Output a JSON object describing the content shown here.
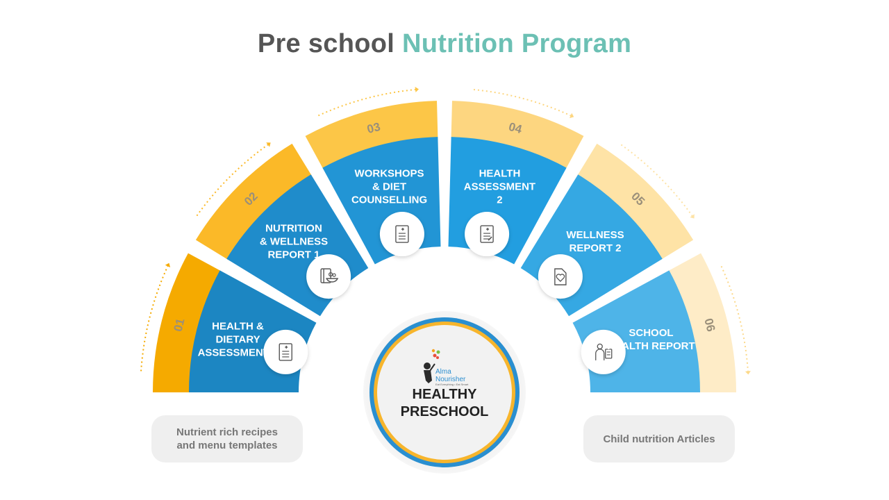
{
  "title": {
    "part1": "Pre school",
    "part2": "Nutrition Program"
  },
  "colors": {
    "title_dark": "#555555",
    "title_accent": "#6cc0b4",
    "center_ring_outer": "#2a8fd0",
    "center_ring_inner": "#f7b52c"
  },
  "center": {
    "logo_name": "Alma Nourisher",
    "logo_tagline": "Eat Everything • Eat Smart",
    "label_line1": "HEALTHY",
    "label_line2": "PRESCHOOL"
  },
  "segments": [
    {
      "number": "01",
      "lines": [
        "HEALTH  &",
        "DIETARY",
        "ASSESSMENT 1"
      ],
      "outer_color": "#f5aa00",
      "inner_color": "#1c86c2",
      "icon": "document-icon"
    },
    {
      "number": "02",
      "lines": [
        "NUTRITION",
        "& WELLNESS",
        "REPORT 1"
      ],
      "outer_color": "#fbb928",
      "inner_color": "#1f8ccb",
      "icon": "recipe-book-icon"
    },
    {
      "number": "03",
      "lines": [
        "WORKSHOPS",
        "& DIET",
        "COUNSELLING"
      ],
      "outer_color": "#fcc647",
      "inner_color": "#2295d5",
      "icon": "document-icon"
    },
    {
      "number": "04",
      "lines": [
        "HEALTH",
        "ASSESSMENT",
        "2"
      ],
      "outer_color": "#fdd680",
      "inner_color": "#229ee0",
      "icon": "report-icon"
    },
    {
      "number": "05",
      "lines": [
        "WELLNESS",
        "REPORT 2"
      ],
      "outer_color": "#fee3a6",
      "inner_color": "#35a8e3",
      "icon": "heart-document-icon"
    },
    {
      "number": "06",
      "lines": [
        "SCHOOL",
        "HEALTH  REPORT"
      ],
      "outer_color": "#feecc7",
      "inner_color": "#4eb4e8",
      "icon": "doctor-clipboard-icon"
    }
  ],
  "pills": {
    "left_line1": "Nutrient rich recipes",
    "left_line2": "and menu templates",
    "right": "Child nutrition Articles"
  }
}
